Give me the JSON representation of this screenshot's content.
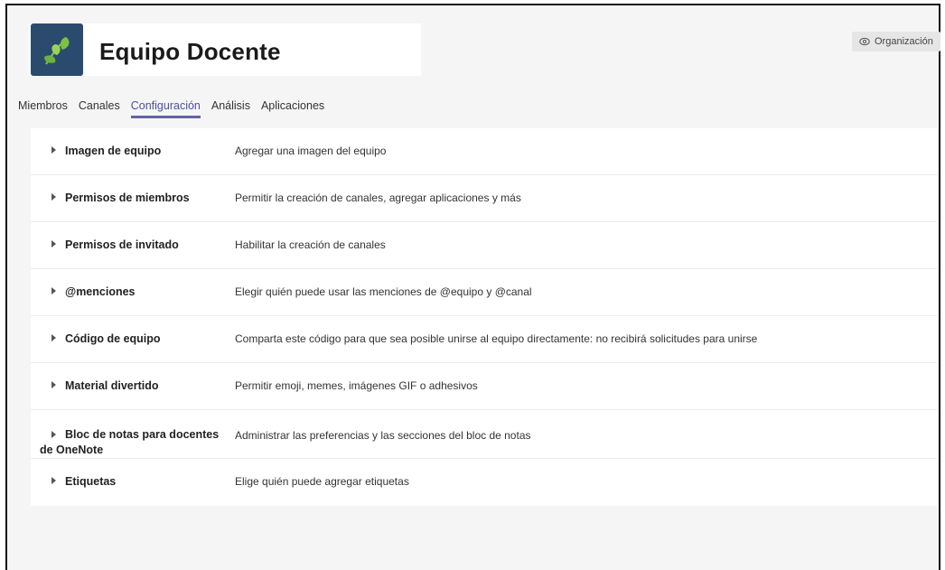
{
  "header": {
    "team_name": "Equipo Docente",
    "org_button_label": "Organización",
    "logo_icon": "leaf-icon",
    "brand_color": "#2a4b6e",
    "accent_color": "#6264a7"
  },
  "tabs": [
    {
      "label": "Miembros",
      "active": false
    },
    {
      "label": "Canales",
      "active": false
    },
    {
      "label": "Configuración",
      "active": true
    },
    {
      "label": "Análisis",
      "active": false
    },
    {
      "label": "Aplicaciones",
      "active": false
    }
  ],
  "settings": [
    {
      "label": "Imagen de equipo",
      "description": "Agregar una imagen del equipo"
    },
    {
      "label": "Permisos de miembros",
      "description": "Permitir la creación de canales, agregar aplicaciones y más"
    },
    {
      "label": "Permisos de invitado",
      "description": "Habilitar la creación de canales"
    },
    {
      "label": "@menciones",
      "description": "Elegir quién puede usar las menciones de @equipo y @canal"
    },
    {
      "label": "Código de equipo",
      "description": "Comparta este código para que sea posible unirse al equipo directamente: no recibirá solicitudes para unirse"
    },
    {
      "label": "Material divertido",
      "description": "Permitir emoji, memes, imágenes GIF o adhesivos"
    },
    {
      "label": "Bloc de notas para docentes de OneNote",
      "description": "Administrar las preferencias y las secciones del bloc de notas"
    },
    {
      "label": "Etiquetas",
      "description": "Elige quién puede agregar etiquetas"
    }
  ]
}
